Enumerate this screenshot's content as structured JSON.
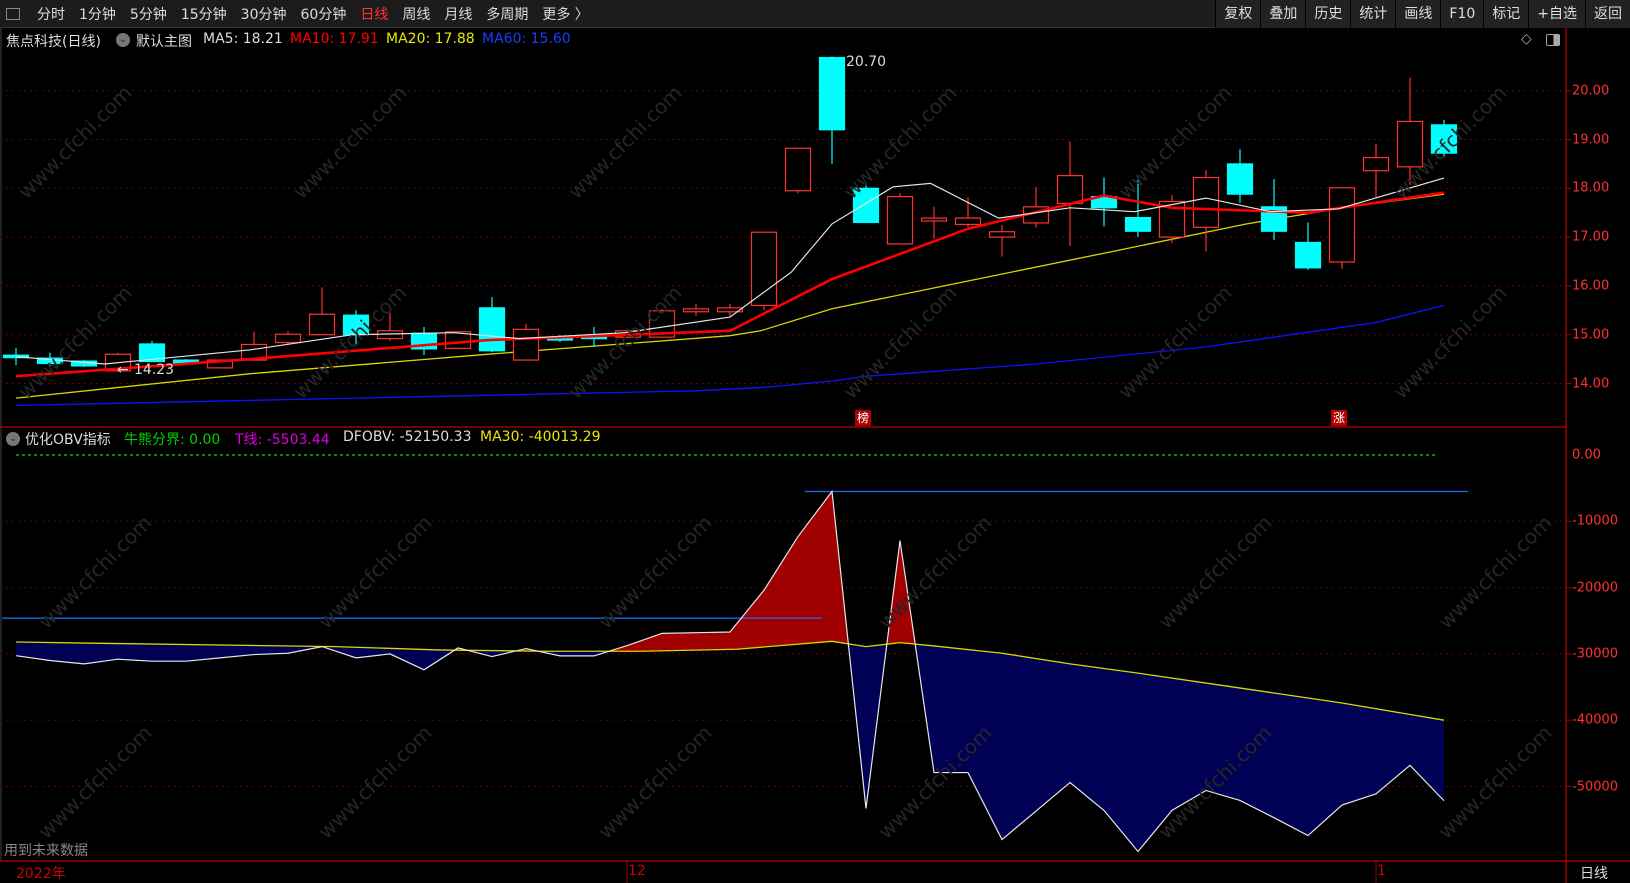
{
  "toolbar": {
    "tabs": [
      "分时",
      "1分钟",
      "5分钟",
      "15分钟",
      "30分钟",
      "60分钟",
      "日线",
      "周线",
      "月线",
      "多周期",
      "更多 〉"
    ],
    "active_tab": "日线",
    "right_buttons": [
      "复权",
      "叠加",
      "历史",
      "统计",
      "画线",
      "F10",
      "标记",
      "+自选",
      "返回"
    ]
  },
  "main_panel": {
    "stock": "焦点科技(日线)",
    "template": "默认主图",
    "ma5": "MA5: 18.21",
    "ma10": "MA10: 17.91",
    "ma20": "MA20: 17.88",
    "ma60": "MA60: 15.60",
    "high_label": "20.70",
    "low_label": "14.23",
    "badge1": "榜",
    "badge2": "涨",
    "axis_labels": [
      "20.00",
      "19.00",
      "18.00",
      "17.00",
      "16.00",
      "15.00",
      "14.00"
    ]
  },
  "obv_panel": {
    "name": "优化OBV指标",
    "bull_bear": "牛熊分界: 0.00",
    "t_line": "T线: -5503.44",
    "dfobv": "DFOBV: -52150.33",
    "ma30": "MA30: -40013.29",
    "axis_labels": [
      "0.00",
      "-10000",
      "-20000",
      "-30000",
      "-40000",
      "-50000"
    ],
    "note": "用到未来数据"
  },
  "time_axis": {
    "labels": [
      "2022年",
      "12",
      "1"
    ],
    "period": "日线"
  },
  "watermark": "www.cfchi.com",
  "colors": {
    "up": "#ff3232",
    "down": "#00ffff",
    "ma5": "#e6e6e6",
    "ma10": "#ff0000",
    "ma20": "#d8d800",
    "ma60": "#1010ff",
    "obv_pos": "#a00000",
    "obv_neg": "#000055",
    "tline": "#1e6cff"
  },
  "chart_data": {
    "type": "candlestick",
    "price_axis": [
      14,
      20
    ],
    "candles": [
      [
        14.58,
        14.53,
        14.73,
        14.38
      ],
      [
        14.52,
        14.41,
        14.63,
        14.36
      ],
      [
        14.46,
        14.36,
        14.48,
        14.34
      ],
      [
        14.26,
        14.6,
        14.63,
        14.23
      ],
      [
        14.81,
        14.45,
        14.87,
        14.44
      ],
      [
        14.48,
        14.41,
        14.5,
        14.39
      ],
      [
        14.32,
        14.48,
        14.48,
        14.32
      ],
      [
        14.48,
        14.8,
        15.06,
        14.48
      ],
      [
        14.84,
        15.01,
        15.07,
        14.79
      ],
      [
        15.0,
        15.42,
        15.97,
        15.0
      ],
      [
        15.4,
        15.0,
        15.5,
        14.79
      ],
      [
        14.92,
        15.08,
        15.45,
        14.87
      ],
      [
        15.03,
        14.71,
        15.16,
        14.58
      ],
      [
        14.72,
        15.06,
        15.06,
        14.72
      ],
      [
        15.55,
        14.67,
        15.77,
        14.64
      ],
      [
        14.48,
        15.11,
        15.22,
        14.48
      ],
      [
        14.95,
        14.89,
        14.99,
        14.85
      ],
      [
        14.96,
        14.92,
        15.16,
        14.75
      ],
      [
        14.95,
        15.08,
        15.12,
        14.93
      ],
      [
        14.95,
        15.49,
        15.52,
        14.95
      ],
      [
        15.47,
        15.53,
        15.63,
        15.38
      ],
      [
        15.47,
        15.55,
        15.63,
        15.38
      ],
      [
        15.6,
        17.1,
        17.1,
        15.5
      ],
      [
        17.95,
        18.82,
        18.82,
        17.9
      ],
      [
        20.68,
        19.2,
        20.7,
        18.5
      ],
      [
        18.0,
        17.3,
        18.1,
        17.3
      ],
      [
        16.86,
        17.83,
        17.9,
        16.86
      ],
      [
        17.33,
        17.39,
        17.62,
        16.96
      ],
      [
        17.26,
        17.39,
        17.82,
        17.2
      ],
      [
        17.0,
        17.11,
        17.25,
        16.6
      ],
      [
        17.29,
        17.62,
        18.03,
        17.2
      ],
      [
        17.69,
        18.26,
        18.96,
        16.82
      ],
      [
        17.83,
        17.6,
        18.22,
        17.22
      ],
      [
        17.4,
        17.12,
        18.17,
        17.0
      ],
      [
        17.0,
        17.73,
        17.86,
        16.88
      ],
      [
        17.2,
        18.22,
        18.37,
        16.71
      ],
      [
        18.5,
        17.88,
        18.8,
        17.7
      ],
      [
        17.62,
        17.12,
        18.19,
        16.94
      ],
      [
        16.89,
        16.37,
        17.3,
        16.33
      ],
      [
        16.49,
        18.01,
        18.01,
        16.35
      ],
      [
        18.36,
        18.63,
        18.91,
        17.82
      ],
      [
        18.44,
        19.37,
        20.27,
        18.07
      ],
      [
        19.3,
        18.72,
        19.4,
        18.63
      ]
    ],
    "ma5": [
      [
        0,
        14.55
      ],
      [
        2.6,
        14.4
      ],
      [
        6.9,
        14.69
      ],
      [
        9.9,
        15.0
      ],
      [
        12.9,
        15.04
      ],
      [
        14.8,
        14.92
      ],
      [
        17.9,
        15.04
      ],
      [
        21,
        15.36
      ],
      [
        22.8,
        16.28
      ],
      [
        24,
        17.27
      ],
      [
        25.8,
        18.03
      ],
      [
        26.9,
        18.1
      ],
      [
        28.9,
        17.39
      ],
      [
        31,
        17.6
      ],
      [
        32.9,
        17.52
      ],
      [
        35,
        17.8
      ],
      [
        36.9,
        17.52
      ],
      [
        38.9,
        17.58
      ],
      [
        42,
        18.21
      ]
    ],
    "ma10": [
      [
        0,
        14.15
      ],
      [
        6.9,
        14.5
      ],
      [
        13.9,
        14.89
      ],
      [
        21,
        15.08
      ],
      [
        24,
        16.14
      ],
      [
        28,
        17.17
      ],
      [
        32,
        17.85
      ],
      [
        34,
        17.6
      ],
      [
        38,
        17.5
      ],
      [
        42,
        17.91
      ]
    ],
    "ma20": [
      [
        0,
        13.7
      ],
      [
        6.9,
        14.2
      ],
      [
        13.9,
        14.6
      ],
      [
        21,
        14.98
      ],
      [
        21.9,
        15.08
      ],
      [
        24,
        15.53
      ],
      [
        28,
        16.1
      ],
      [
        32,
        16.67
      ],
      [
        36.2,
        17.27
      ],
      [
        39,
        17.6
      ],
      [
        42,
        17.88
      ]
    ],
    "ma60": [
      [
        0,
        13.55
      ],
      [
        10,
        13.7
      ],
      [
        20,
        13.85
      ],
      [
        22,
        13.92
      ],
      [
        24,
        14.05
      ],
      [
        25,
        14.15
      ],
      [
        30,
        14.4
      ],
      [
        35,
        14.75
      ],
      [
        40,
        15.25
      ],
      [
        42,
        15.6
      ]
    ],
    "obv_axis": [
      -60000,
      0
    ],
    "dfobv": [
      -30270,
      -31000,
      -31500,
      -30800,
      -31100,
      -31100,
      -30600,
      -30100,
      -29900,
      -28900,
      -30600,
      -30000,
      -32400,
      -29100,
      -30400,
      -29200,
      -30300,
      -30300,
      -28700,
      -26900,
      -26800,
      -26700,
      -20400,
      -12300,
      -5500,
      -53300,
      -12900,
      -47900,
      -47900,
      -58000,
      -53700,
      -49400,
      -53600,
      -59800,
      -53600,
      -50600,
      -52100,
      -54700,
      -57400,
      -52800,
      -51100,
      -46800,
      -52150
    ],
    "ma30": [
      [
        0,
        -28200
      ],
      [
        2.5,
        -28400
      ],
      [
        6.5,
        -28700
      ],
      [
        9.4,
        -28900
      ],
      [
        12.4,
        -29400
      ],
      [
        15.5,
        -29600
      ],
      [
        18.4,
        -29600
      ],
      [
        21.2,
        -29300
      ],
      [
        24,
        -28100
      ],
      [
        25,
        -28900
      ],
      [
        26,
        -28300
      ],
      [
        27,
        -28800
      ],
      [
        29,
        -29900
      ],
      [
        31,
        -31500
      ],
      [
        33,
        -32900
      ],
      [
        35,
        -34400
      ],
      [
        37,
        -35900
      ],
      [
        39,
        -37400
      ],
      [
        42,
        -40000
      ]
    ],
    "t_line": -5503.44,
    "t_line_range": [
      23.2,
      42.7
    ],
    "support_line": -24600,
    "support_range": [
      -0.4,
      23.7
    ],
    "bull_bear_line": 0
  }
}
